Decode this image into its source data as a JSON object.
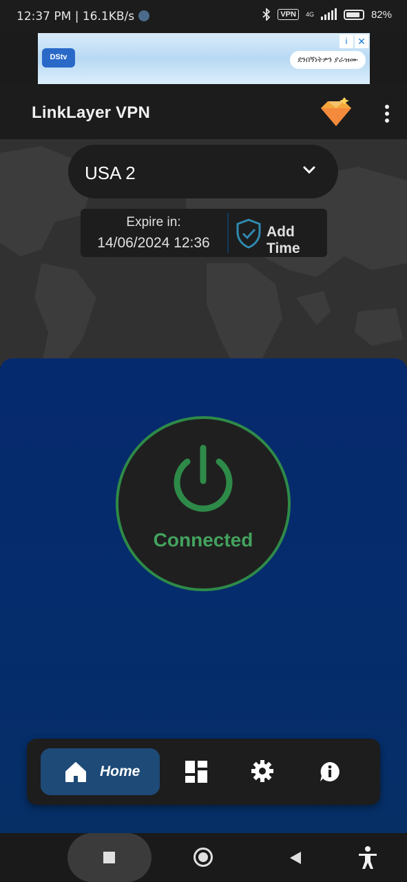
{
  "status_bar": {
    "time_speed": "12:37 PM | 16.1KB/s",
    "vpn_badge": "VPN",
    "network": "4G",
    "battery": "82%"
  },
  "ad": {
    "brand": "DStv",
    "button_text": "ደንበኝነትዎን ያራዝሙ"
  },
  "app_bar": {
    "title": "LinkLayer VPN",
    "premium_icon": "diamond-crown-icon",
    "menu_icon": "more-vert-icon"
  },
  "server": {
    "name": "USA 2",
    "dropdown_icon": "chevron-down-icon"
  },
  "expiry": {
    "label": "Expire in:",
    "date": "14/06/2024 12:36",
    "add_time_label": "Add Time",
    "shield_icon": "shield-check-icon"
  },
  "connection": {
    "status": "Connected",
    "status_color": "#43a35e",
    "ring_color": "#2e8a48"
  },
  "bottom_nav": {
    "items": [
      {
        "label": "Home",
        "icon": "home-icon",
        "active": true
      },
      {
        "label": "",
        "icon": "dashboard-icon",
        "active": false
      },
      {
        "label": "",
        "icon": "gear-icon",
        "active": false
      },
      {
        "label": "",
        "icon": "info-bubble-icon",
        "active": false
      }
    ]
  },
  "colors": {
    "panel_blue": "#062a6e",
    "active_nav": "#1e4a78",
    "surface": "#1d1d1d"
  }
}
